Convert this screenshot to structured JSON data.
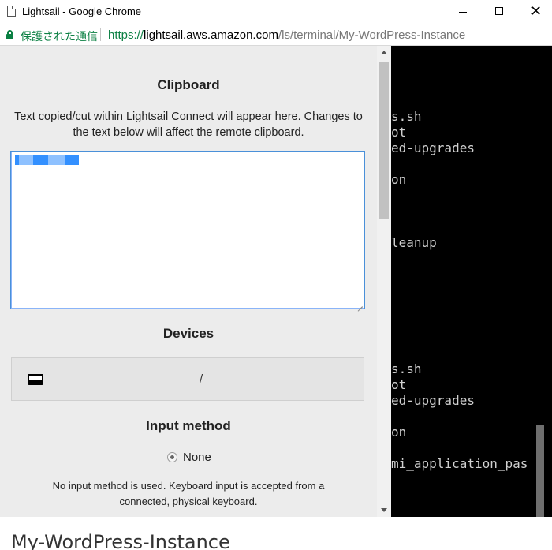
{
  "window": {
    "title": "Lightsail - Google Chrome",
    "minimize_icon": "minimize-icon",
    "maximize_icon": "maximize-icon",
    "close_icon": "close-icon",
    "close_glyph": "✕"
  },
  "address_bar": {
    "secure_label": "保護された通信",
    "url_scheme": "https://",
    "url_host": "lightsail.aws.amazon.com",
    "url_path": "/ls/terminal/My-WordPress-Instance"
  },
  "clipboard": {
    "title": "Clipboard",
    "description": "Text copied/cut within Lightsail Connect will appear here. Changes to the text below will affect the remote clipboard."
  },
  "devices": {
    "title": "Devices",
    "device_label": "/",
    "icon": "drive-icon"
  },
  "input_method": {
    "title": "Input method",
    "option_label": "None",
    "selected": true,
    "description": "No input method is used. Keyboard input is accepted from a connected, physical keyboard."
  },
  "terminal": {
    "lines": [
      "s.sh",
      "ot",
      "ed-upgrades",
      "",
      "on",
      "",
      "",
      "",
      "leanup",
      "",
      "",
      "",
      "",
      "",
      "",
      "",
      "s.sh",
      "ot",
      "ed-upgrades",
      "",
      "on",
      "",
      "mi_application_pas"
    ]
  },
  "page": {
    "instance_name": "My-WordPress-Instance"
  }
}
